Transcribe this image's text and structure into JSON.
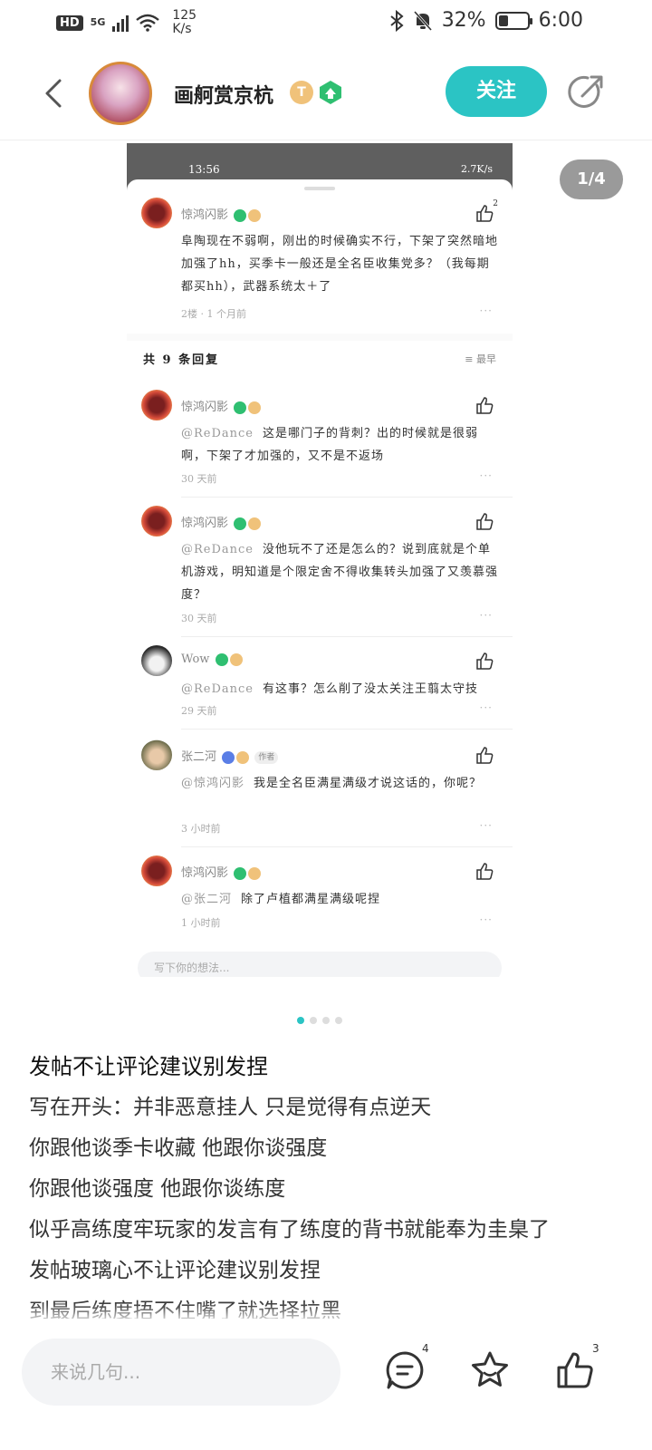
{
  "status_bar": {
    "hd": "HD",
    "network": "5G",
    "speed_value": "125",
    "speed_unit": "K/s",
    "battery": "32%",
    "battery_level": 0.32,
    "time": "6:00"
  },
  "header": {
    "username": "画舸赏京杭",
    "badge_letter": "T",
    "follow_label": "关注"
  },
  "carousel": {
    "counter": "1/4",
    "current_index": 0,
    "total": 4
  },
  "screenshot": {
    "time": "13:56",
    "status": "2.7K/s",
    "main_comment": {
      "user": "惊鸿闪影",
      "likes": "2",
      "text": "阜陶现在不弱啊，刚出的时候确实不行，下架了突然暗地加强了hh，买季卡一般还是全名臣收集党多？（我每期都买hh），武器系统太＋了",
      "meta": "2楼 · 1 个月前"
    },
    "replies_header": "共 9 条回复",
    "sort_label": "最早",
    "replies": [
      {
        "user": "惊鸿闪影",
        "at": "@ReDance",
        "text": "这是哪门子的背刺？出的时候就是很弱啊，下架了才加强的，又不是不返场",
        "meta": "30 天前"
      },
      {
        "user": "惊鸿闪影",
        "at": "@ReDance",
        "text": "没他玩不了还是怎么的？说到底就是个单机游戏，明知道是个限定舍不得收集转头加强了又羡慕强度？",
        "meta": "30 天前"
      },
      {
        "user": "Wow",
        "at": "@ReDance",
        "text": "有这事？怎么削了没太关注王翦太守技",
        "meta": "29 天前"
      },
      {
        "user": "张二河",
        "author_tag": "作者",
        "at": "@惊鸿闪影",
        "text": "我是全名臣满星满级才说这话的，你呢？",
        "meta": "3 小时前"
      },
      {
        "user": "惊鸿闪影",
        "at": "@张二河",
        "text": "除了卢植都满星满级呢捏",
        "meta": "1 小时前"
      }
    ],
    "input_placeholder": "写下你的想法..."
  },
  "post": {
    "title": "发帖不让评论建议别发捏",
    "lines": [
      "写在开头：并非恶意挂人 只是觉得有点逆天",
      "你跟他谈季卡收藏 他跟你谈强度",
      "你跟他谈强度 他跟你谈练度",
      "似乎高练度牢玩家的发言有了练度的背书就能奉为圭臬了",
      "发帖玻璃心不让评论建议别发捏",
      "到最后练度捂不住嘴了就选择拉黑"
    ]
  },
  "bottom_bar": {
    "comment_placeholder": "来说几句...",
    "comment_count": "4",
    "like_count": "3"
  },
  "colors": {
    "accent": "#2bc4c4",
    "badge_green": "#2fbf71",
    "badge_gold": "#f0c27a"
  }
}
